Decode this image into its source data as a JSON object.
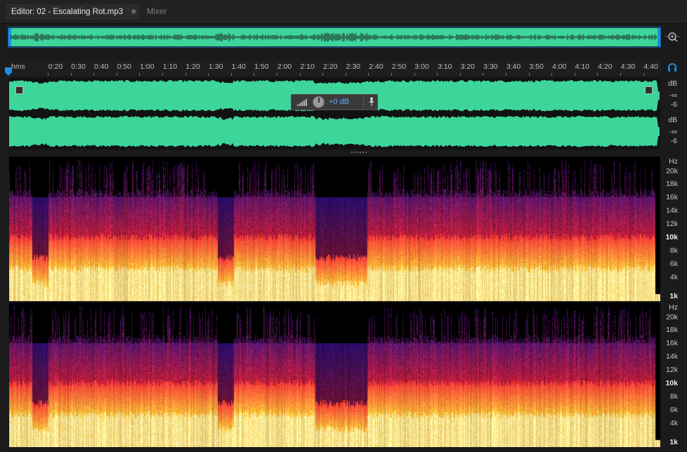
{
  "tabs": {
    "editor_label": "Editor: 02 - Escalating Rot.mp3",
    "mixer_label": "Mixer",
    "menu_glyph": "≡"
  },
  "ruler": {
    "unit_label": "hms",
    "ticks": [
      "0:20",
      "0:30",
      "0:40",
      "0:50",
      "1:00",
      "1:10",
      "1:20",
      "1:30",
      "1:40",
      "1:50",
      "2:00",
      "2:10",
      "2:20",
      "2:30",
      "2:40",
      "2:50",
      "3:00",
      "3:10",
      "3:20",
      "3:30",
      "3:40",
      "3:50",
      "4:00",
      "4:10",
      "4:20",
      "4:30",
      "4:40"
    ]
  },
  "waveform": {
    "channel1_db": [
      "dB",
      "-∞",
      "-6"
    ],
    "channel2_db": [
      "dB",
      "-∞",
      "-6"
    ],
    "color": "#3dd59a"
  },
  "hud": {
    "volume": "+0 dB"
  },
  "spectrogram": {
    "hz_labels": [
      {
        "text": "Hz",
        "bold": false
      },
      {
        "text": "20k",
        "bold": false
      },
      {
        "text": "18k",
        "bold": false
      },
      {
        "text": "16k",
        "bold": false
      },
      {
        "text": "14k",
        "bold": false
      },
      {
        "text": "12k",
        "bold": false
      },
      {
        "text": "10k",
        "bold": true
      },
      {
        "text": "8k",
        "bold": false
      },
      {
        "text": "6k",
        "bold": false
      },
      {
        "text": "4k",
        "bold": false
      },
      {
        "text": "1k",
        "bold": true
      }
    ]
  },
  "colors": {
    "accent": "#1d8fe0",
    "waveform": "#3dd59a",
    "spectrum_low": "#ffd26a",
    "spectrum_mid": "#e8362a",
    "spectrum_high": "#5a2a8a"
  },
  "icons": [
    "zoom-icon",
    "headphones-icon",
    "playhead-marker-icon",
    "pin-icon",
    "volume-knob-icon",
    "menu-icon"
  ]
}
